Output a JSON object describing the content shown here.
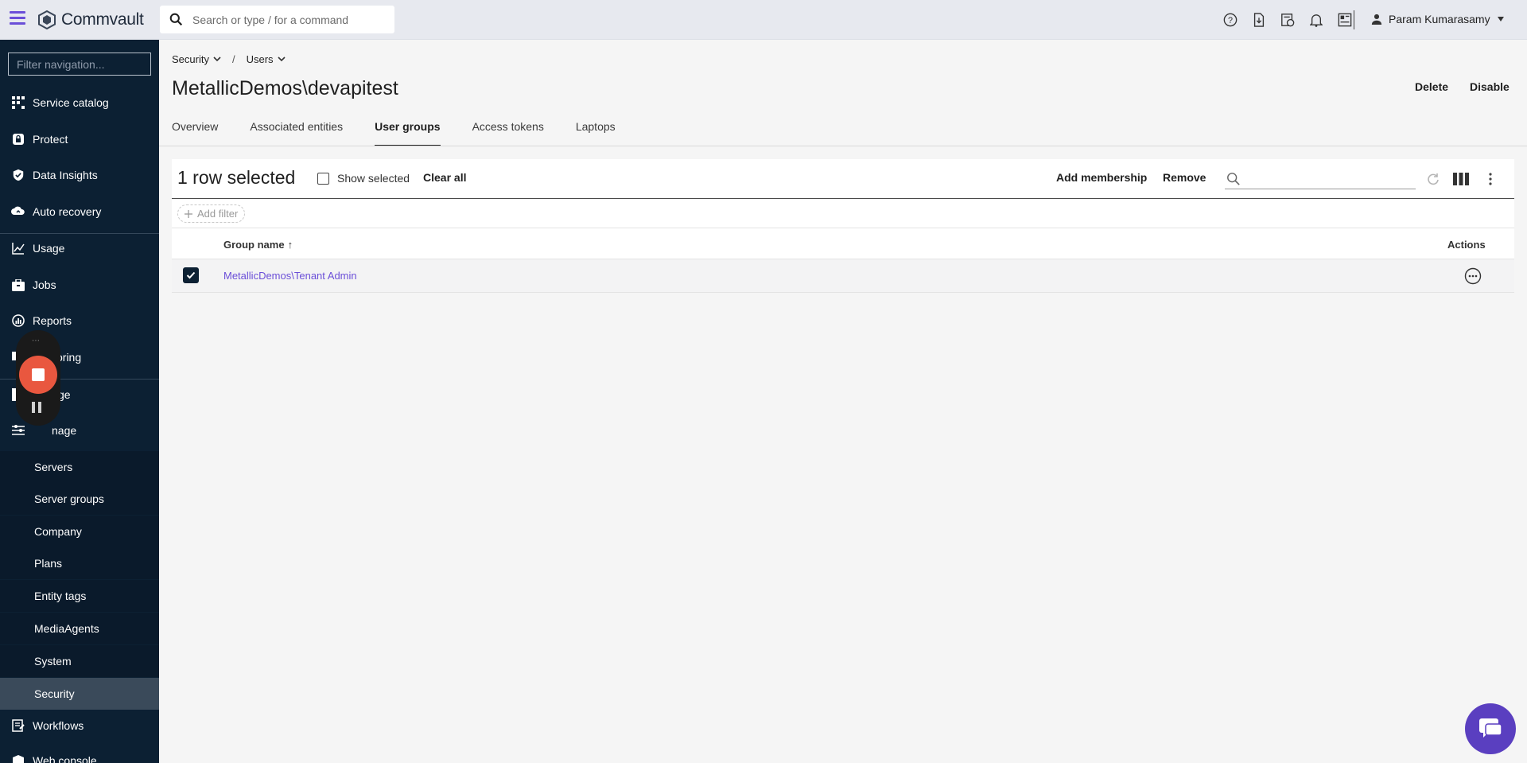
{
  "app": {
    "brand": "Commvault",
    "search_placeholder": "Search or type / for a command",
    "user_name": "Param Kumarasamy",
    "top_icons": [
      "help-icon",
      "download-icon",
      "schedule-icon",
      "notification-bell-icon",
      "dashboard-icon"
    ]
  },
  "sidebar": {
    "filter_placeholder": "Filter navigation...",
    "items": [
      {
        "label": "Service catalog",
        "icon": "grid-icon"
      },
      {
        "label": "Protect",
        "icon": "shield-lock-icon"
      },
      {
        "label": "Data Insights",
        "icon": "shield-check-icon"
      },
      {
        "label": "Auto recovery",
        "icon": "cloud-recovery-icon"
      },
      {
        "label": "Usage",
        "icon": "chart-line-icon"
      },
      {
        "label": "Jobs",
        "icon": "briefcase-icon"
      },
      {
        "label": "Reports",
        "icon": "report-icon"
      },
      {
        "label": "oring",
        "icon": "monitor-icon"
      },
      {
        "label": "ge",
        "icon": "storage-icon"
      },
      {
        "label": "nage",
        "icon": "manage-icon"
      }
    ],
    "sub_items": [
      {
        "label": "Servers"
      },
      {
        "label": "Server groups"
      },
      {
        "label": "Company"
      },
      {
        "label": "Plans"
      },
      {
        "label": "Entity tags"
      },
      {
        "label": "MediaAgents"
      },
      {
        "label": "System"
      },
      {
        "label": "Security"
      }
    ],
    "bottom_items": [
      {
        "label": "Workflows",
        "icon": "workflow-icon"
      },
      {
        "label": "Web console",
        "icon": "console-icon"
      }
    ]
  },
  "breadcrumb": {
    "items": [
      "Security",
      "Users"
    ],
    "separator": "/"
  },
  "page": {
    "title": "MetallicDemos\\devapitest",
    "delete_label": "Delete",
    "disable_label": "Disable"
  },
  "tabs": [
    {
      "label": "Overview",
      "active": false
    },
    {
      "label": "Associated entities",
      "active": false
    },
    {
      "label": "User groups",
      "active": true
    },
    {
      "label": "Access tokens",
      "active": false
    },
    {
      "label": "Laptops",
      "active": false
    }
  ],
  "grid": {
    "selection_text": "1 row selected",
    "show_selected_label": "Show selected",
    "clear_all_label": "Clear all",
    "add_membership_label": "Add membership",
    "remove_label": "Remove",
    "search_placeholder": "",
    "add_filter_label": "Add filter",
    "columns": {
      "name": "Group name",
      "sort_indicator": "↑",
      "actions": "Actions"
    },
    "rows": [
      {
        "group_name": "MetallicDemos\\Tenant Admin",
        "selected": true
      }
    ]
  },
  "colors": {
    "accent": "#6b4fd8",
    "sidebar_bg": "#0c2033",
    "record_button": "#e9573f",
    "chat_button": "#5a3fc0"
  }
}
